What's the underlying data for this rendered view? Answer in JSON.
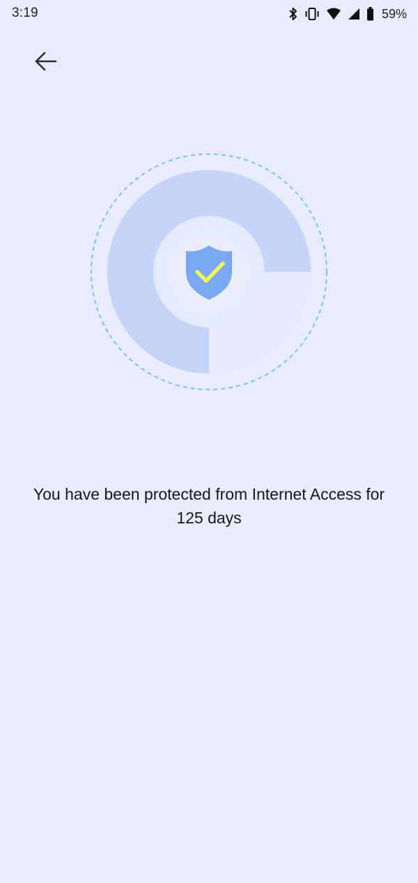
{
  "status_bar": {
    "time": "3:19",
    "battery_percent": "59%",
    "icons": [
      "bluetooth-icon",
      "vibrate-icon",
      "wifi-icon",
      "cell-signal-icon",
      "battery-icon"
    ]
  },
  "header": {
    "back_icon": "arrow-left-icon"
  },
  "hero": {
    "icon": "shield-check-icon",
    "progress_fraction": 0.75,
    "colors": {
      "background": "#e8ecfd",
      "ring_fill": "#c5d5fa",
      "ring_track": "#e6eafc",
      "dashed_circle": "#78c6e0",
      "inner_circle": "#e9edfc",
      "shield": "#7aa8f5",
      "check": "#f2f55a"
    }
  },
  "message": {
    "text": "You have been protected from Internet Access for 125 days"
  }
}
